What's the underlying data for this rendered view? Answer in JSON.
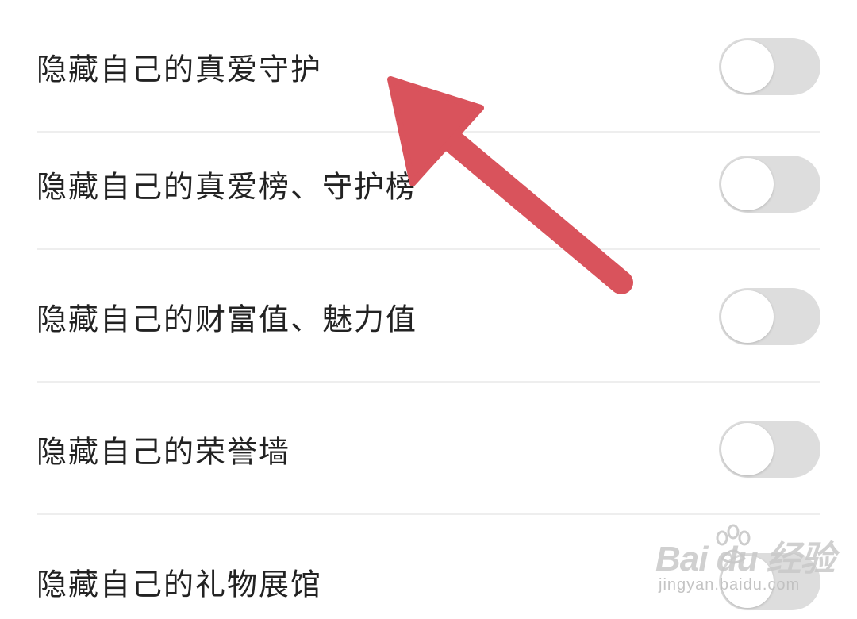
{
  "settings": {
    "items": [
      {
        "label": "隐藏自己的真爱守护",
        "enabled": false
      },
      {
        "label": "隐藏自己的真爱榜、守护榜",
        "enabled": false
      },
      {
        "label": "隐藏自己的财富值、魅力值",
        "enabled": false
      },
      {
        "label": "隐藏自己的荣誉墙",
        "enabled": false
      },
      {
        "label": "隐藏自己的礼物展馆",
        "enabled": false
      }
    ]
  },
  "colors": {
    "toggle_off": "#dddddd",
    "knob": "#ffffff",
    "divider": "#eeeeee",
    "arrow": "#d9535c",
    "text": "#222222"
  },
  "annotation": {
    "icon": "arrow-up-left-icon"
  },
  "watermark": {
    "logo": "Bai du 经验",
    "url": "jingyan.baidu.com"
  }
}
